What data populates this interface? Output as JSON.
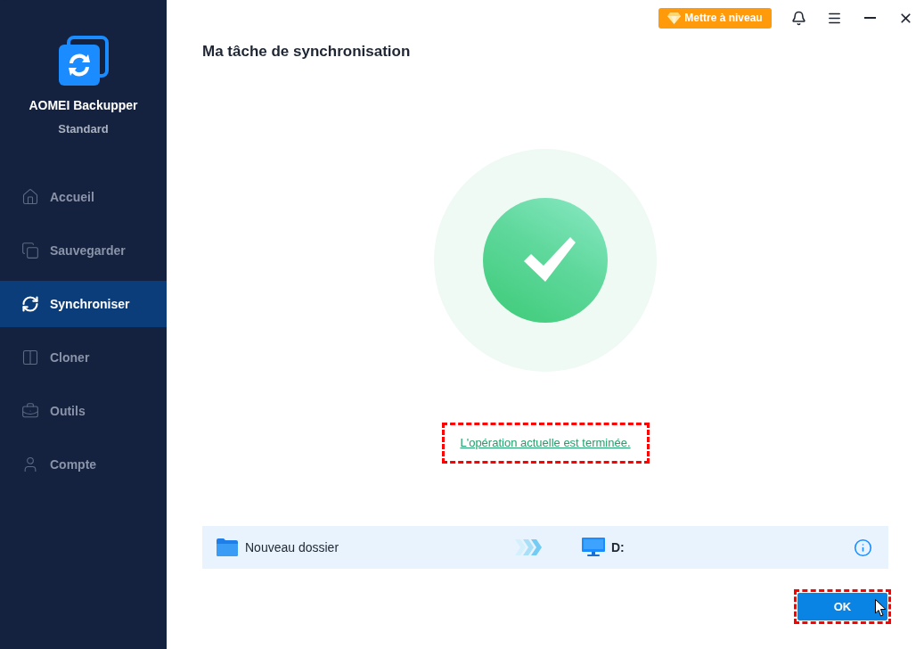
{
  "app": {
    "name": "AOMEI Backupper",
    "edition": "Standard"
  },
  "sidebar": {
    "items": [
      {
        "label": "Accueil",
        "kind": "home",
        "selected": false
      },
      {
        "label": "Sauvegarder",
        "kind": "backup",
        "selected": false
      },
      {
        "label": "Synchroniser",
        "kind": "sync",
        "selected": true
      },
      {
        "label": "Cloner",
        "kind": "clone",
        "selected": false
      },
      {
        "label": "Outils",
        "kind": "tools",
        "selected": false
      },
      {
        "label": "Compte",
        "kind": "account",
        "selected": false
      }
    ]
  },
  "topbar": {
    "upgrade_button": "Mettre à niveau"
  },
  "page": {
    "title": "Ma tâche de synchronisation",
    "status": {
      "kind": "success",
      "message": "L'opération actuelle est terminée.",
      "highlighted": true
    }
  },
  "sync": {
    "source": "Nouveau dossier",
    "destination": "D:"
  },
  "ok_button": {
    "label": "OK",
    "highlighted": true
  }
}
